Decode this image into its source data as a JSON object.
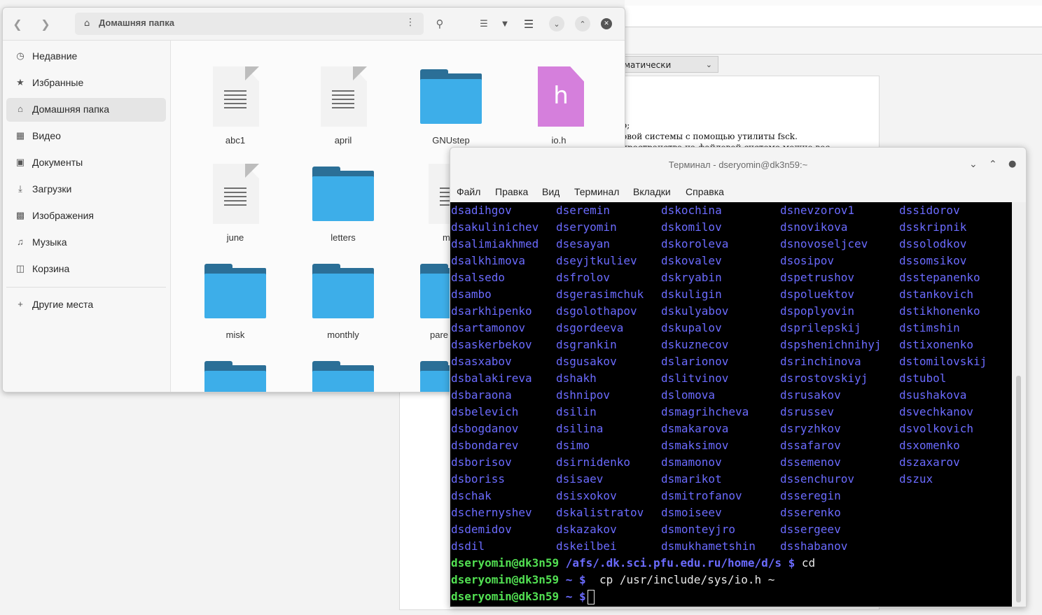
{
  "background_doc": {
    "combo_value": "матически",
    "text_line1": "о;",
    "text_line2": "овой системы с помощью утилиты fsck.",
    "text_line3": "пространства на файловой системе можно вос"
  },
  "file_manager": {
    "path_label": "Домашняя папка",
    "sidebar": [
      {
        "label": "Недавние",
        "icon": "clock-icon"
      },
      {
        "label": "Избранные",
        "icon": "star-icon"
      },
      {
        "label": "Домашняя папка",
        "icon": "home-icon",
        "selected": true
      },
      {
        "label": "Видео",
        "icon": "film-icon"
      },
      {
        "label": "Документы",
        "icon": "document-icon"
      },
      {
        "label": "Загрузки",
        "icon": "download-icon"
      },
      {
        "label": "Изображения",
        "icon": "image-icon"
      },
      {
        "label": "Музыка",
        "icon": "music-icon"
      },
      {
        "label": "Корзина",
        "icon": "trash-icon"
      }
    ],
    "other_places": "Другие места",
    "files": [
      {
        "name": "abc1",
        "kind": "text"
      },
      {
        "name": "april",
        "kind": "text"
      },
      {
        "name": "GNUstep",
        "kind": "folder"
      },
      {
        "name": "io.h",
        "kind": "header"
      },
      {
        "name": "june",
        "kind": "text"
      },
      {
        "name": "letters",
        "kind": "folder"
      },
      {
        "name": "m",
        "kind": "text"
      },
      {
        "name": "misk",
        "kind": "folder"
      },
      {
        "name": "monthly",
        "kind": "folder"
      },
      {
        "name": "pare",
        "kind": "folder"
      },
      {
        "name": "",
        "kind": "folder"
      },
      {
        "name": "",
        "kind": "folder"
      },
      {
        "name": "",
        "kind": "folder"
      }
    ],
    "header_letter": "h"
  },
  "terminal": {
    "title": "Терминал - dseryomin@dk3n59:~",
    "menu": [
      "Файл",
      "Правка",
      "Вид",
      "Терминал",
      "Вкладки",
      "Справка"
    ],
    "listing": [
      [
        "dsadihgov",
        "dseremin",
        "dskochina",
        "dsnevzorov1",
        "dssidorov"
      ],
      [
        "dsakulinichev",
        "dseryomin",
        "dskomilov",
        "dsnovikova",
        "dsskripnik"
      ],
      [
        "dsalimiakhmed",
        "dsesayan",
        "dskoroleva",
        "dsnovoseljcev",
        "dssolodkov"
      ],
      [
        "dsalkhimova",
        "dseyjtkuliev",
        "dskovalev",
        "dsosipov",
        "dssomsikov"
      ],
      [
        "dsalsedo",
        "dsfrolov",
        "dskryabin",
        "dspetrushov",
        "dsstepanenko"
      ],
      [
        "dsambo",
        "dsgerasimchuk",
        "dskuligin",
        "dspoluektov",
        "dstankovich"
      ],
      [
        "dsarkhipenko",
        "dsgolothapov",
        "dskulyabov",
        "dspoplyovin",
        "dstikhonenko"
      ],
      [
        "dsartamonov",
        "dsgordeeva",
        "dskupalov",
        "dsprilepskij",
        "dstimshin"
      ],
      [
        "dsaskerbekov",
        "dsgrankin",
        "dskuznecov",
        "dspshenichnihyj",
        "dstixonenko"
      ],
      [
        "dsasxabov",
        "dsgusakov",
        "dslarionov",
        "dsrinchinova",
        "dstomilovskij"
      ],
      [
        "dsbalakireva",
        "dshakh",
        "dslitvinov",
        "dsrostovskiyj",
        "dstubol"
      ],
      [
        "dsbaraona",
        "dshnipov",
        "dslomova",
        "dsrusakov",
        "dsushakova"
      ],
      [
        "dsbelevich",
        "dsilin",
        "dsmagrihcheva",
        "dsrussev",
        "dsvechkanov"
      ],
      [
        "dsbogdanov",
        "dsilina",
        "dsmakarova",
        "dsryzhkov",
        "dsvolkovich"
      ],
      [
        "dsbondarev",
        "dsimo",
        "dsmaksimov",
        "dssafarov",
        "dsxomenko"
      ],
      [
        "dsborisov",
        "dsirnidenko",
        "dsmamonov",
        "dssemenov",
        "dszaxarov"
      ],
      [
        "dsboriss",
        "dsisaev",
        "dsmarikot",
        "dssenchurov",
        "dszux"
      ],
      [
        "dschak",
        "dsisxokov",
        "dsmitrofanov",
        "dsseregin",
        ""
      ],
      [
        "dschernyshev",
        "dskalistratov",
        "dsmoiseev",
        "dsserenko",
        ""
      ],
      [
        "dsdemidov",
        "dskazakov",
        "dsmonteyjro",
        "dssergeev",
        ""
      ],
      [
        "dsdil",
        "dskeilbei",
        "dsmukhametshin",
        "dsshabanov",
        ""
      ]
    ],
    "prompts": [
      {
        "userhost": "dseryomin@dk3n59",
        "path": "/afs/.dk.sci.pfu.edu.ru/home/d/s $",
        "cmd": "cd"
      },
      {
        "userhost": "dseryomin@dk3n59",
        "path": "~ $",
        "cmd": " cp /usr/include/sys/io.h ~"
      },
      {
        "userhost": "dseryomin@dk3n59",
        "path": "~ $",
        "cmd": ""
      }
    ]
  },
  "colors": {
    "folder": "#3daee9",
    "header_file": "#d57fdc",
    "term_dir": "#6b6bff",
    "term_prompt": "#52e052"
  }
}
